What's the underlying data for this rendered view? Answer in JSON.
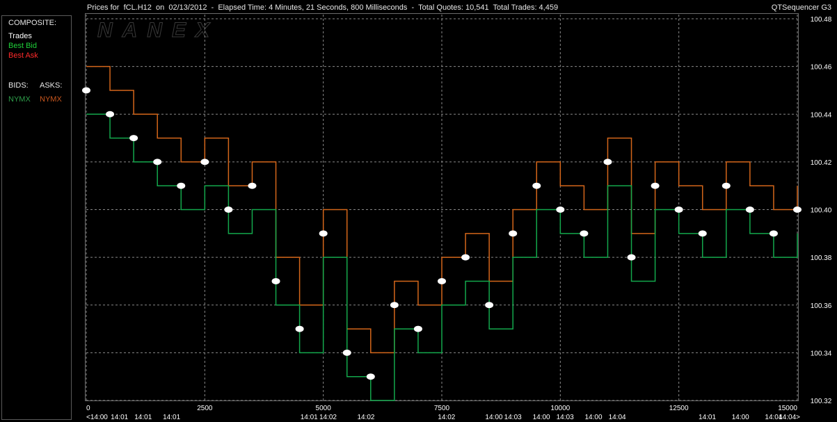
{
  "header": {
    "title": "Prices for  fCL.H12  on  02/13/2012  -  Elapsed Time: 4 Minutes, 21 Seconds, 800 Milliseconds  -  Total Quotes: 10,541  Total Trades: 4,459",
    "app_name": "QTSequencer G3",
    "watermark": "NANEX"
  },
  "legend": {
    "composite_label": "COMPOSITE:",
    "trades_label": "Trades",
    "best_bid_label": "Best Bid",
    "best_ask_label": "Best Ask",
    "bids_label": "BIDS:",
    "asks_label": "ASKS:",
    "bid_exchange": "NYMX",
    "ask_exchange": "NYMX"
  },
  "colors": {
    "trades": "#ffffff",
    "best_bid": "#1fd13a",
    "best_ask": "#ff2a2a",
    "bid_line": "#13a84c",
    "ask_line": "#d4661a",
    "nymx_bid": "#2e9e4a",
    "nymx_ask": "#c8561e",
    "grid": "#8a8a8a"
  },
  "chart_data": {
    "type": "line",
    "title": "Prices for  fCL.H12  on  02/13/2012",
    "xlim": [
      0,
      15000
    ],
    "ylim": [
      100.32,
      100.48
    ],
    "x_ticks": [
      0,
      2500,
      5000,
      7500,
      10000,
      12500,
      15000
    ],
    "y_ticks": [
      100.32,
      100.34,
      100.36,
      100.38,
      100.4,
      100.42,
      100.44,
      100.46,
      100.48
    ],
    "y_tick_labels": [
      "100.32",
      "100.34",
      "100.36",
      "100.38",
      "100.40",
      "100.42",
      "100.44",
      "100.46",
      "100.48"
    ],
    "time_labels": [
      {
        "x": 0,
        "label": "<14:00"
      },
      {
        "x": 700,
        "label": "14:01"
      },
      {
        "x": 1200,
        "label": "14:01"
      },
      {
        "x": 1800,
        "label": "14:01"
      },
      {
        "x": 4700,
        "label": "14:01"
      },
      {
        "x": 5100,
        "label": "14:02"
      },
      {
        "x": 5900,
        "label": "14:02"
      },
      {
        "x": 7600,
        "label": "14:02"
      },
      {
        "x": 8600,
        "label": "14:00"
      },
      {
        "x": 9000,
        "label": "14:03"
      },
      {
        "x": 9600,
        "label": "14:00"
      },
      {
        "x": 10100,
        "label": "14:03"
      },
      {
        "x": 10700,
        "label": "14:00"
      },
      {
        "x": 11200,
        "label": "14:04"
      },
      {
        "x": 13100,
        "label": "14:01"
      },
      {
        "x": 13800,
        "label": "14:00"
      },
      {
        "x": 14500,
        "label": "14:04"
      },
      {
        "x": 14800,
        "label": "14:04>"
      }
    ],
    "trades": {
      "name": "Trades",
      "x": [
        0,
        500,
        1000,
        1500,
        2000,
        2500,
        3000,
        3500,
        4000,
        4500,
        5000,
        5500,
        6000,
        6500,
        7000,
        7500,
        8000,
        8500,
        9000,
        9500,
        10000,
        10500,
        11000,
        11500,
        12000,
        12500,
        13000,
        13500,
        14000,
        14500,
        15000
      ],
      "y": [
        100.45,
        100.44,
        100.43,
        100.42,
        100.41,
        100.42,
        100.4,
        100.41,
        100.37,
        100.35,
        100.39,
        100.34,
        100.33,
        100.36,
        100.35,
        100.37,
        100.38,
        100.36,
        100.39,
        100.41,
        100.4,
        100.39,
        100.42,
        100.38,
        100.41,
        100.4,
        100.39,
        100.41,
        100.4,
        100.39,
        100.4
      ]
    },
    "best_bid": {
      "name": "Best Bid",
      "x": [
        0,
        500,
        1000,
        1500,
        2000,
        2500,
        3000,
        3500,
        4000,
        4500,
        5000,
        5500,
        6000,
        6500,
        7000,
        7500,
        8000,
        8500,
        9000,
        9500,
        10000,
        10500,
        11000,
        11500,
        12000,
        12500,
        13000,
        13500,
        14000,
        14500,
        15000
      ],
      "y": [
        100.44,
        100.43,
        100.42,
        100.41,
        100.4,
        100.41,
        100.39,
        100.4,
        100.36,
        100.34,
        100.38,
        100.33,
        100.32,
        100.35,
        100.34,
        100.36,
        100.37,
        100.35,
        100.38,
        100.4,
        100.39,
        100.38,
        100.41,
        100.37,
        100.4,
        100.39,
        100.38,
        100.4,
        100.39,
        100.38,
        100.39
      ]
    },
    "best_ask": {
      "name": "Best Ask",
      "x": [
        0,
        500,
        1000,
        1500,
        2000,
        2500,
        3000,
        3500,
        4000,
        4500,
        5000,
        5500,
        6000,
        6500,
        7000,
        7500,
        8000,
        8500,
        9000,
        9500,
        10000,
        10500,
        11000,
        11500,
        12000,
        12500,
        13000,
        13500,
        14000,
        14500,
        15000
      ],
      "y": [
        100.46,
        100.45,
        100.44,
        100.43,
        100.42,
        100.43,
        100.41,
        100.42,
        100.38,
        100.36,
        100.4,
        100.35,
        100.34,
        100.37,
        100.36,
        100.38,
        100.39,
        100.37,
        100.4,
        100.42,
        100.41,
        100.4,
        100.43,
        100.39,
        100.42,
        100.41,
        100.4,
        100.42,
        100.41,
        100.4,
        100.41
      ]
    },
    "grid": true,
    "legend_position": "left-panel"
  }
}
